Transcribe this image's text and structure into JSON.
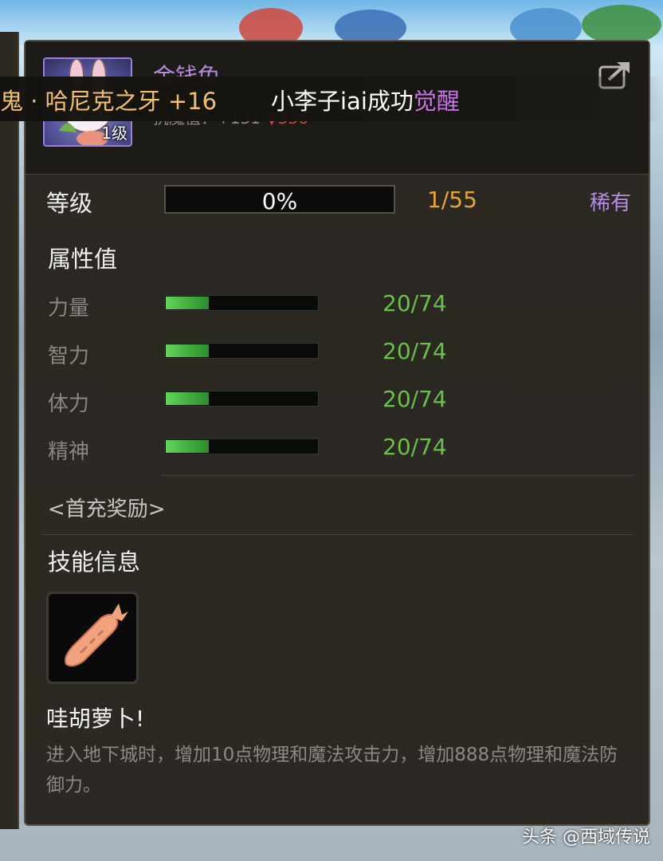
{
  "pet": {
    "name": "金钱兔",
    "level_badge": "1级",
    "stat_line_prefix": "抗魔值：+131",
    "stat_line_change": "▼336"
  },
  "notice": {
    "item": "鬼 · 哈尼克之牙 +16",
    "message_prefix": "小李子iai成功",
    "message_highlight": "觉醒"
  },
  "level": {
    "label": "等级",
    "progress_text": "0%",
    "progress_fraction": 0.0,
    "count": "1/55",
    "rarity": "稀有"
  },
  "attributes": {
    "title": "属性值",
    "items": [
      {
        "label": "力量",
        "value": "20/74",
        "fraction": 0.27
      },
      {
        "label": "智力",
        "value": "20/74",
        "fraction": 0.27
      },
      {
        "label": "体力",
        "value": "20/74",
        "fraction": 0.27
      },
      {
        "label": "精神",
        "value": "20/74",
        "fraction": 0.27
      }
    ]
  },
  "reward": "<首充奖励>",
  "skill": {
    "section_title": "技能信息",
    "icon": "carrot-icon",
    "name": "哇胡萝卜!",
    "description": "进入地下城时，增加10点物理和魔法攻击力，增加888点物理和魔法防御力。"
  },
  "watermark": "头条 @西域传说",
  "colors": {
    "rarity": "#b88be5",
    "attr_value": "#69c04a",
    "level_count": "#e7a43a",
    "notice_item": "#f0c070",
    "awaken": "#c774e6"
  }
}
